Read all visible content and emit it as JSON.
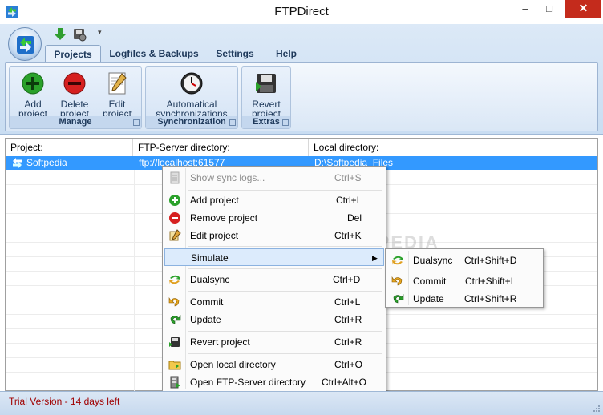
{
  "window": {
    "title": "FTPDirect",
    "minimize": "–",
    "maximize": "□",
    "close": "✕"
  },
  "ribbon": {
    "tabs": [
      {
        "label": "Projects",
        "active": true
      },
      {
        "label": "Logfiles & Backups",
        "active": false
      },
      {
        "label": "Settings",
        "active": false
      },
      {
        "label": "Help",
        "active": false
      }
    ],
    "groups": [
      {
        "label": "Manage",
        "buttons": [
          {
            "line1": "Add",
            "line2": "project",
            "icon": "add-icon"
          },
          {
            "line1": "Delete",
            "line2": "project",
            "icon": "delete-icon"
          },
          {
            "line1": "Edit",
            "line2": "project",
            "icon": "edit-icon"
          }
        ]
      },
      {
        "label": "Synchronization",
        "buttons": [
          {
            "line1": "Automatical",
            "line2": "synchronizations",
            "icon": "clock-icon"
          }
        ]
      },
      {
        "label": "Extras",
        "buttons": [
          {
            "line1": "Revert",
            "line2": "project",
            "icon": "floppy-icon"
          }
        ]
      }
    ]
  },
  "table": {
    "columns": [
      "Project:",
      "FTP-Server directory:",
      "Local directory:"
    ],
    "rows": [
      {
        "project": "Softpedia",
        "ftp": "ftp://localhost:61577",
        "local": "D:\\Softpedia_Files",
        "selected": true
      }
    ]
  },
  "context_menu": {
    "items": [
      {
        "label": "Show sync logs...",
        "shortcut": "Ctrl+S",
        "disabled": true,
        "icon": "log-icon"
      },
      {
        "label": "Add project",
        "shortcut": "Ctrl+I",
        "icon": "add-icon"
      },
      {
        "label": "Remove project",
        "shortcut": "Del",
        "icon": "remove-icon"
      },
      {
        "label": "Edit project",
        "shortcut": "Ctrl+K",
        "icon": "edit-icon"
      },
      {
        "label": "Simulate",
        "shortcut": "",
        "submenu": true,
        "highlighted": true,
        "icon": ""
      },
      {
        "label": "Dualsync",
        "shortcut": "Ctrl+D",
        "icon": "dualsync-icon"
      },
      {
        "label": "Commit",
        "shortcut": "Ctrl+L",
        "icon": "commit-icon"
      },
      {
        "label": "Update",
        "shortcut": "Ctrl+R",
        "icon": "update-icon"
      },
      {
        "label": "Revert project",
        "shortcut": "Ctrl+R",
        "icon": "revert-icon"
      },
      {
        "label": "Open local directory",
        "shortcut": "Ctrl+O",
        "icon": "folder-icon"
      },
      {
        "label": "Open FTP-Server directory",
        "shortcut": "Ctrl+Alt+O",
        "icon": "server-icon"
      }
    ]
  },
  "submenu": {
    "items": [
      {
        "label": "Dualsync",
        "shortcut": "Ctrl+Shift+D",
        "icon": "dualsync-icon"
      },
      {
        "label": "Commit",
        "shortcut": "Ctrl+Shift+L",
        "icon": "commit-icon"
      },
      {
        "label": "Update",
        "shortcut": "Ctrl+Shift+R",
        "icon": "update-icon"
      }
    ]
  },
  "watermark": "SOFTPEDIA",
  "status": {
    "text": "Trial Version - 14 days left"
  },
  "colors": {
    "selection": "#3399ff",
    "close": "#c42b1c",
    "status_text": "#a00000"
  }
}
